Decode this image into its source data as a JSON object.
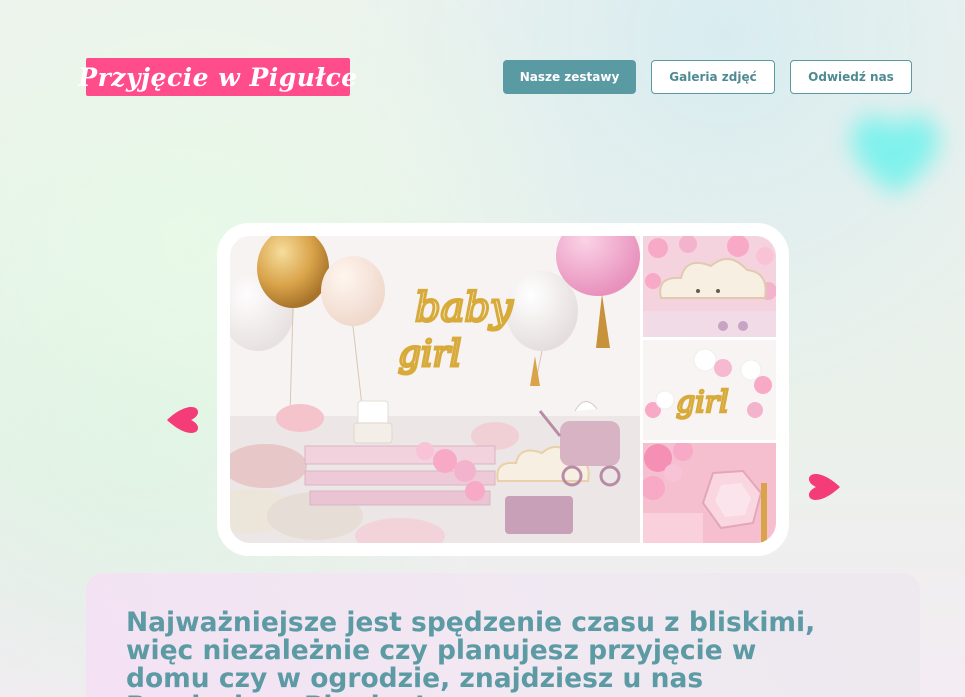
{
  "header": {
    "logo_text": "Przyjęcie w Pigułce",
    "nav": [
      {
        "label": "Nasze zestawy",
        "active": true
      },
      {
        "label": "Galeria zdjęć",
        "active": false
      },
      {
        "label": "Odwiedź nas",
        "active": false
      }
    ]
  },
  "carousel": {
    "main_photo_text": {
      "line1": "baby",
      "line2": "girl"
    },
    "thumb2_text": "girl",
    "prev_icon": "heart-left-arrow-icon",
    "next_icon": "heart-right-arrow-icon"
  },
  "intro": {
    "headline": "Najważniejsze jest spędzenie czasu z bliskimi, więc niezależnie czy planujesz przyjęcie w domu czy w ogrodzie, znajdziesz u nas Przyjęcie w Pigułce!"
  },
  "colors": {
    "brand_pink": "#ff4d8b",
    "teal": "#5a9aa2",
    "headline_teal": "#5c9aa4",
    "glow_cyan": "#6ef2ec"
  }
}
